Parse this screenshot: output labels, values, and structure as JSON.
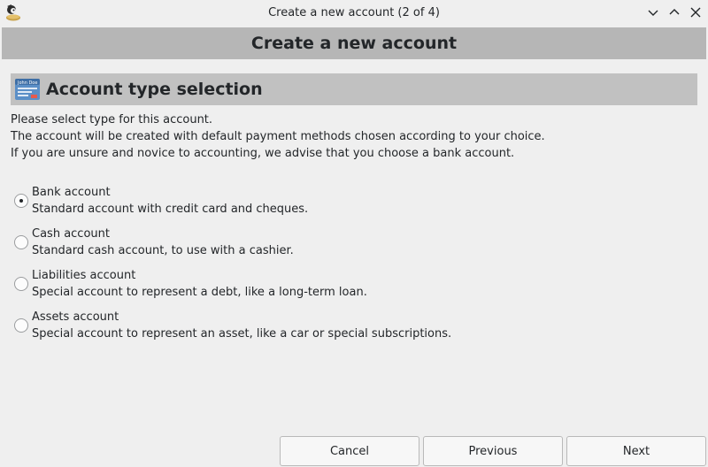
{
  "window": {
    "title": "Create a new account (2 of 4)",
    "controls": [
      "minimize",
      "maximize",
      "close"
    ]
  },
  "header": {
    "title": "Create a new account"
  },
  "section": {
    "title": "Account type selection",
    "icon": "bank-card-icon"
  },
  "intro": {
    "line1": "Please select type for this account.",
    "line2": "The account will be created with default payment methods chosen according to your choice.",
    "line3": "If you are unsure and novice to accounting, we advise that you choose a bank account."
  },
  "options": [
    {
      "label": "Bank account",
      "description": "Standard account with credit card and cheques.",
      "checked": true
    },
    {
      "label": "Cash account",
      "description": "Standard cash account, to use with a cashier.",
      "checked": false
    },
    {
      "label": "Liabilities account",
      "description": "Special account to represent a debt, like a long-term loan.",
      "checked": false
    },
    {
      "label": "Assets account",
      "description": "Special account to represent an asset, like a car or special subscriptions.",
      "checked": false
    }
  ],
  "buttons": {
    "cancel": "Cancel",
    "previous": "Previous",
    "next": "Next"
  },
  "card_icon_text": "John Doe",
  "colors": {
    "header_bg": "#b6b6b6",
    "section_bg": "#c1c1c1",
    "window_bg": "#efefef"
  }
}
